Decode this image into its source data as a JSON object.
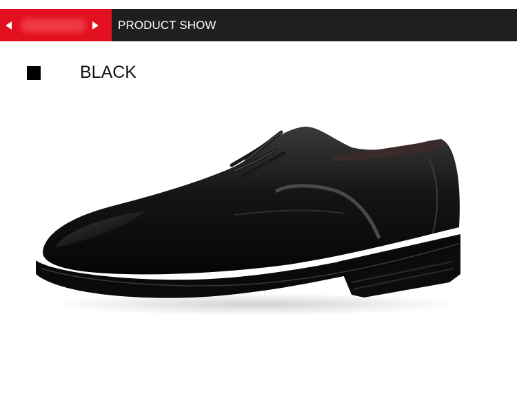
{
  "header": {
    "title": "PRODUCT SHOW",
    "prev_icon": "triangle-left-icon",
    "next_icon": "triangle-right-icon",
    "accent_color": "#e3101f",
    "bar_color": "#1f1f1f"
  },
  "variant": {
    "color_name": "BLACK",
    "swatch_color": "#000000"
  },
  "product": {
    "image_subject": "black leather derby dress shoe"
  }
}
